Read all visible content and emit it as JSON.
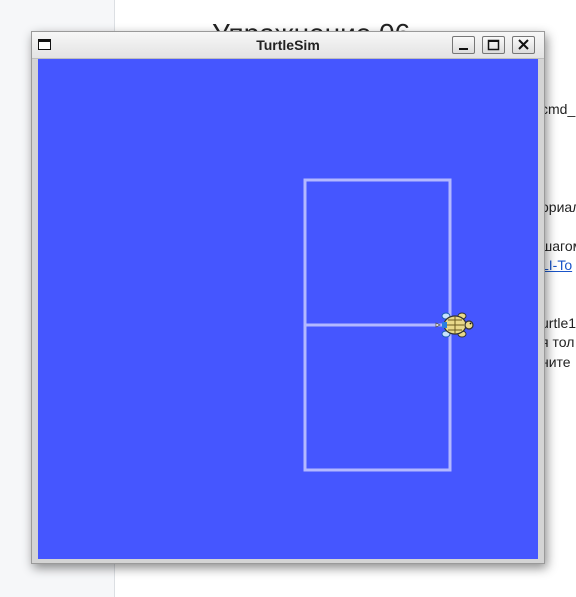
{
  "background_page": {
    "heading": "Упражнение 06",
    "lines": [
      {
        "text": "cmd_"
      },
      {
        "text": "ориал"
      },
      {
        "text": "шагом"
      },
      {
        "text": "LI-To",
        "link": true
      },
      {
        "text": "urtle1"
      },
      {
        "text": "я тол"
      },
      {
        "text": "ните"
      }
    ]
  },
  "window": {
    "title": "TurtleSim",
    "buttons": {
      "minimize": "minimize",
      "maximize": "maximize",
      "close": "close"
    }
  },
  "turtlesim": {
    "background_color": "#4556ff",
    "pen_color": "#b3b8ff",
    "turtle_color": "#e8d98a"
  }
}
